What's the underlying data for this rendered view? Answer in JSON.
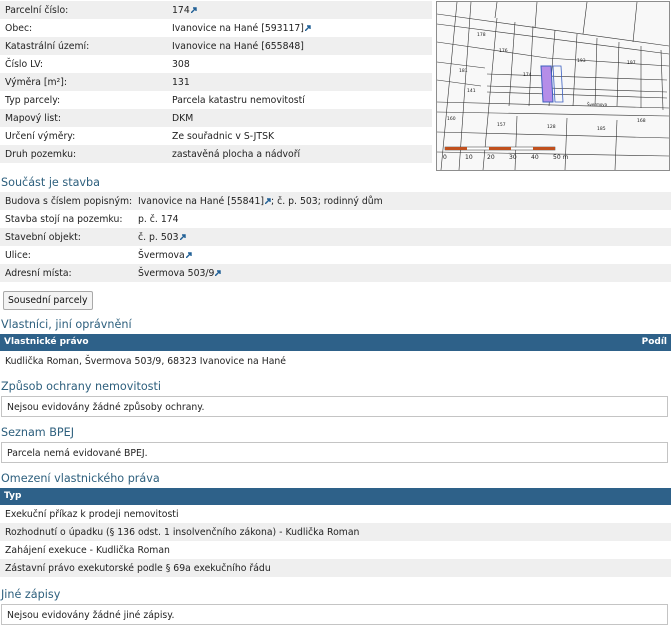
{
  "parcel_info": [
    {
      "label": "Parcelní číslo:",
      "value": "174",
      "link": true,
      "ext": true
    },
    {
      "label": "Obec:",
      "value": "Ivanovice na Hané [593117]",
      "link": true,
      "ext": true
    },
    {
      "label": "Katastrální území:",
      "value": "Ivanovice na Hané [655848]",
      "link": true,
      "ext": false
    },
    {
      "label": "Číslo LV:",
      "value": "308",
      "link": true,
      "ext": false
    },
    {
      "label": "Výměra [m²]:",
      "value": "131",
      "link": false,
      "ext": false
    },
    {
      "label": "Typ parcely:",
      "value": "Parcela katastru nemovitostí",
      "link": false,
      "ext": false
    },
    {
      "label": "Mapový list:",
      "value": "DKM",
      "link": false,
      "ext": false
    },
    {
      "label": "Určení výměry:",
      "value": "Ze souřadnic v S-JTSK",
      "link": false,
      "ext": false
    },
    {
      "label": "Druh pozemku:",
      "value": "zastavěná plocha a nádvoří",
      "link": false,
      "ext": false
    }
  ],
  "map": {
    "scale_labels": [
      "0",
      "10",
      "20",
      "30",
      "40",
      "50 m"
    ],
    "parcel_labels": [
      "178",
      "176",
      "174",
      "181",
      "193",
      "197",
      "160",
      "157",
      "128",
      "185",
      "141",
      "168"
    ],
    "street_label": "Švermova",
    "highlight_color": "#b58de8"
  },
  "building_section": {
    "title": "Součást je stavba",
    "rows": [
      {
        "label": "Budova s číslem popisným:",
        "link": "Ivanovice na Hané [55841]",
        "ext": true,
        "suffix": "; č. p. 503; rodinný dům"
      },
      {
        "label": "Stavba stojí na pozemku:",
        "prefix": "p. č. ",
        "link": "174",
        "ext": false,
        "suffix": ""
      },
      {
        "label": "Stavební objekt:",
        "link": "č. p. 503",
        "ext": true,
        "suffix": ""
      },
      {
        "label": "Ulice:",
        "link": "Švermova",
        "ext": true,
        "suffix": ""
      },
      {
        "label": "Adresní místa:",
        "link": "Švermova 503/9",
        "ext": true,
        "suffix": ""
      }
    ]
  },
  "neighbors_button": "Sousední parcely",
  "owners": {
    "title": "Vlastníci, jiní oprávnění",
    "col1": "Vlastnické právo",
    "col2": "Podíl",
    "owner": "Kudlička Roman, Švermova 503/9, 68323 Ivanovice na Hané"
  },
  "protection": {
    "title": "Způsob ochrany nemovitosti",
    "text": "Nejsou evidovány žádné způsoby ochrany."
  },
  "bpej": {
    "title": "Seznam BPEJ",
    "text": "Parcela nemá evidované BPEJ."
  },
  "restrictions": {
    "title": "Omezení vlastnického práva",
    "col": "Typ",
    "rows": [
      "Exekuční příkaz k prodeji nemovitosti",
      "Rozhodnutí o úpadku (§ 136 odst. 1 insolvenčního zákona) - Kudlička Roman",
      "Zahájení exekuce - Kudlička Roman",
      "Zástavní právo exekutorské podle § 69a exekučního řádu"
    ]
  },
  "other": {
    "title": "Jiné zápisy",
    "text": "Nejsou evidovány žádné jiné zápisy."
  },
  "colors": {
    "accent": "#2e6189",
    "link": "#1f5f95",
    "title": "#2d5f7d",
    "row_alt": "#efefef"
  }
}
